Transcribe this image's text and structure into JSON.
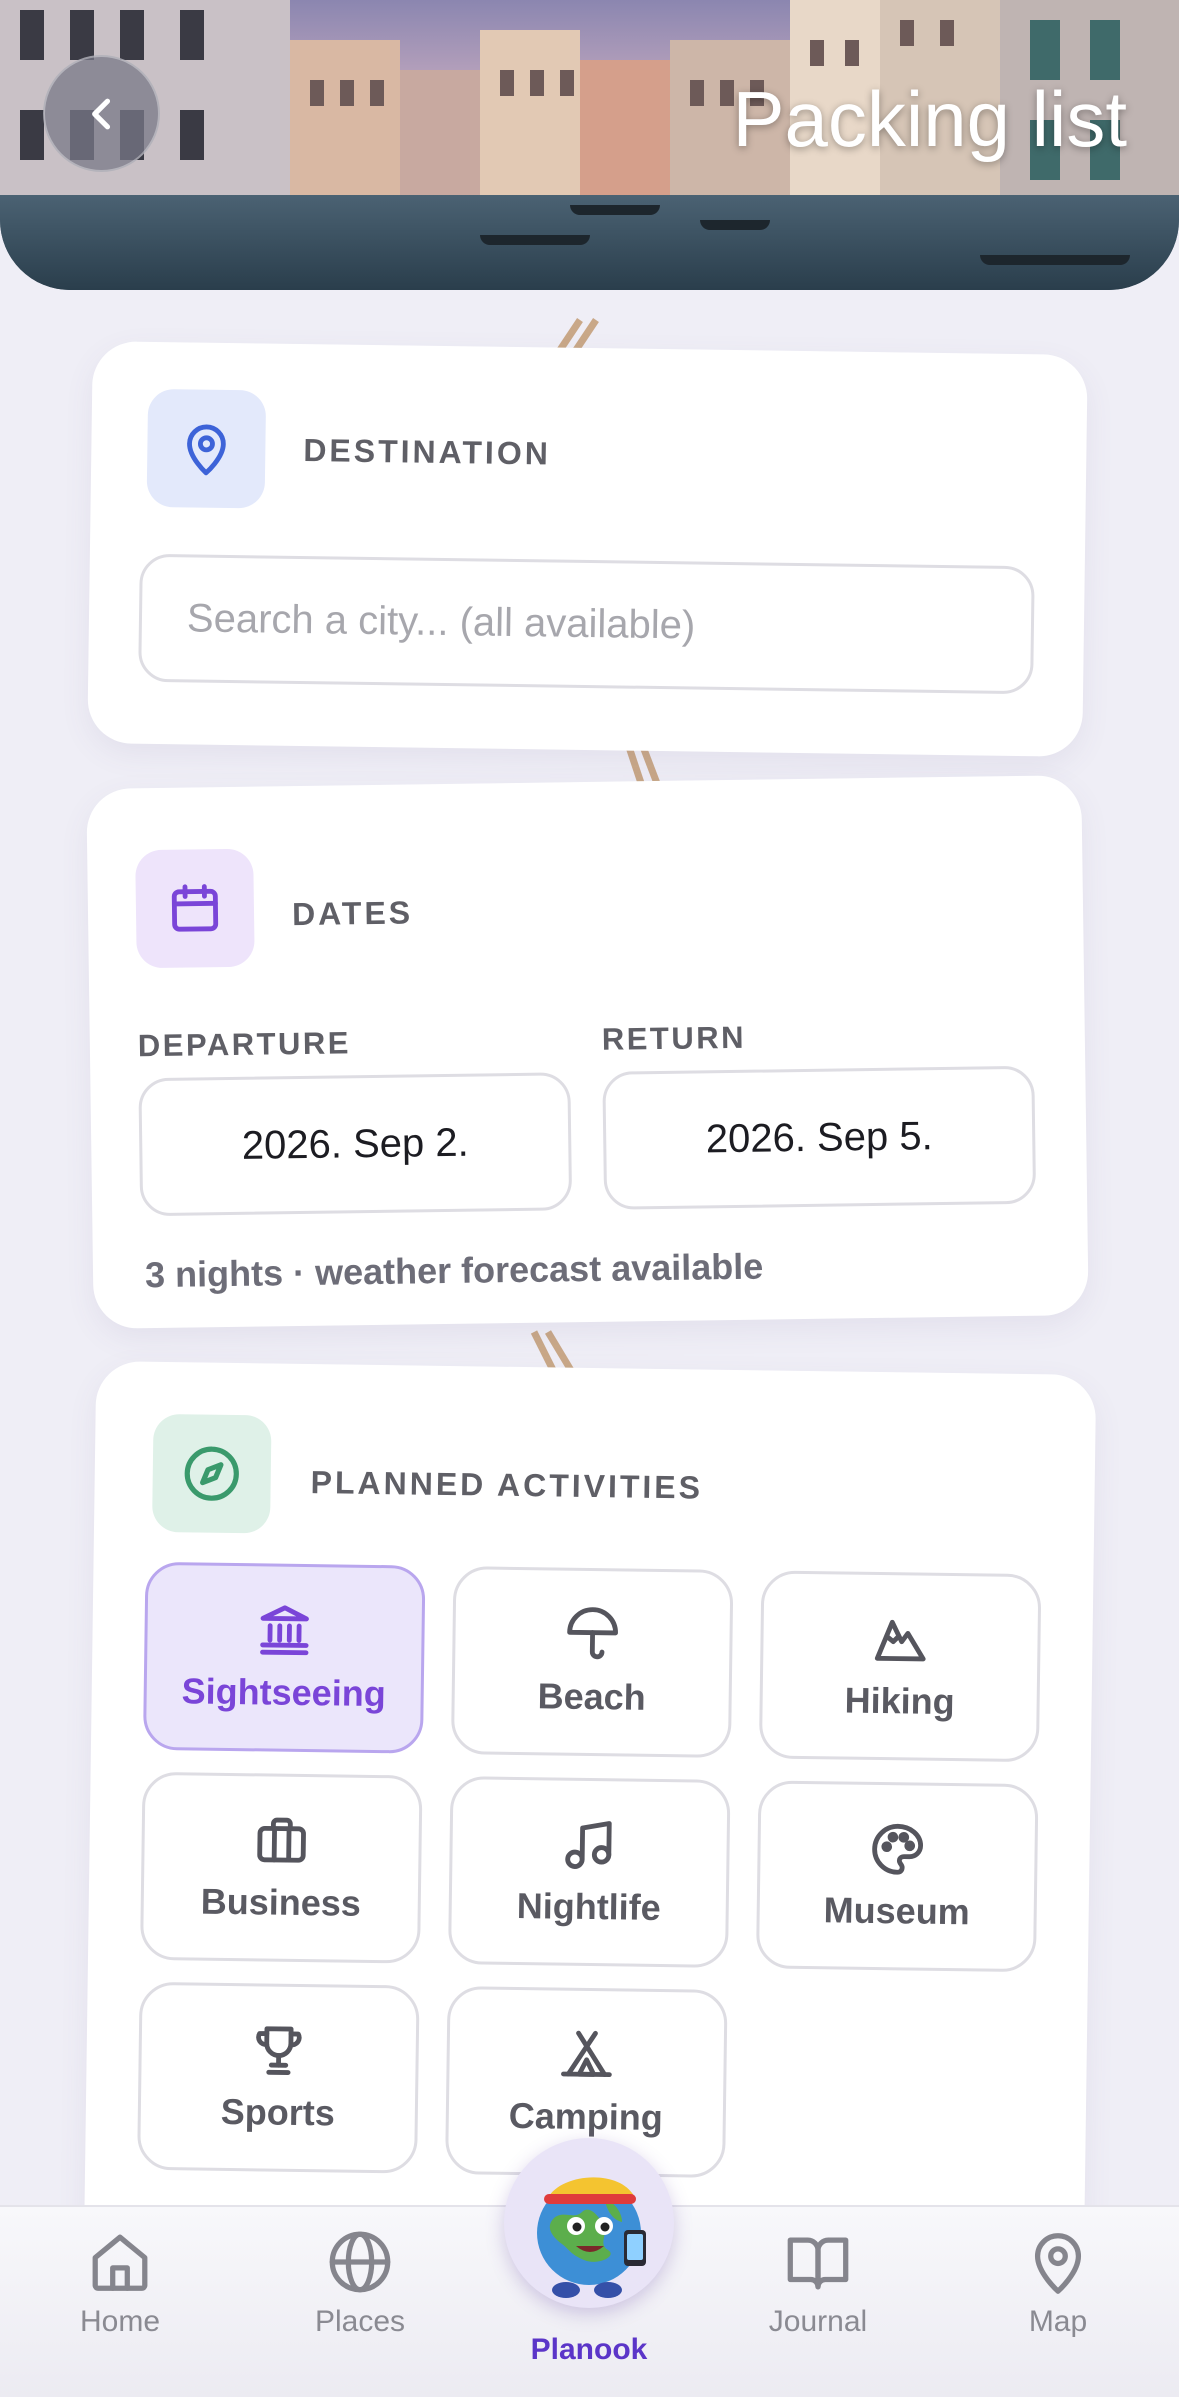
{
  "header": {
    "title": "Packing list",
    "back_icon": "chevron-left-icon"
  },
  "destination": {
    "label": "DESTINATION",
    "icon": "map-pin-icon",
    "placeholder": "Search a city... (all available)"
  },
  "dates": {
    "label": "DATES",
    "icon": "calendar-icon",
    "departure_label": "DEPARTURE",
    "departure_value": "2026. Sep 2.",
    "return_label": "RETURN",
    "return_value": "2026. Sep 5.",
    "summary": "3 nights · weather forecast available"
  },
  "activities": {
    "label": "PLANNED ACTIVITIES",
    "icon": "compass-icon",
    "items": [
      {
        "label": "Sightseeing",
        "icon": "landmark-icon",
        "selected": true
      },
      {
        "label": "Beach",
        "icon": "umbrella-icon",
        "selected": false
      },
      {
        "label": "Hiking",
        "icon": "mountain-icon",
        "selected": false
      },
      {
        "label": "Business",
        "icon": "briefcase-icon",
        "selected": false
      },
      {
        "label": "Nightlife",
        "icon": "music-icon",
        "selected": false
      },
      {
        "label": "Museum",
        "icon": "palette-icon",
        "selected": false
      },
      {
        "label": "Sports",
        "icon": "trophy-icon",
        "selected": false
      },
      {
        "label": "Camping",
        "icon": "tent-icon",
        "selected": false
      }
    ]
  },
  "nav": {
    "items": [
      {
        "label": "Home",
        "icon": "home-icon"
      },
      {
        "label": "Places",
        "icon": "globe-icon"
      },
      {
        "label": "Planook",
        "icon": "mascot-icon",
        "active": true
      },
      {
        "label": "Journal",
        "icon": "book-icon"
      },
      {
        "label": "Map",
        "icon": "map-pin-icon"
      }
    ]
  },
  "colors": {
    "accent": "#7a45d8",
    "nav_active": "#5b35c8",
    "background": "#efeef6"
  }
}
